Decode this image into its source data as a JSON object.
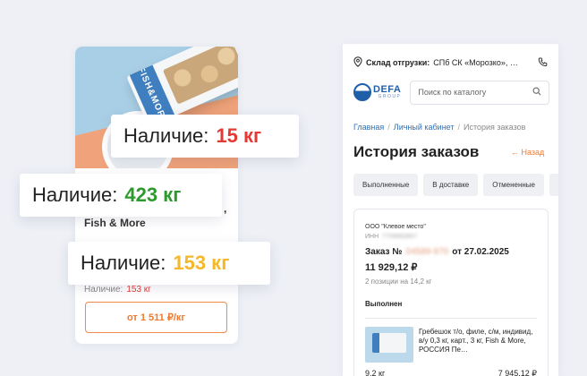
{
  "product": {
    "name_tail": "Fish & More",
    "name_clip": ",",
    "stock_label": "Наличие:",
    "stock_value": "153 кг",
    "price_button": "от 1 511 ₽/кг",
    "image_brand": "FISH&MORE"
  },
  "badges": [
    {
      "label": "Наличие:",
      "value": "15 кг",
      "color": "#e53935"
    },
    {
      "label": "Наличие:",
      "value": "423 кг",
      "color": "#2e9a2e"
    },
    {
      "label": "Наличие:",
      "value": "153 кг",
      "color": "#f5b82a"
    }
  ],
  "mobile": {
    "warehouse_label": "Склад отгрузки:",
    "warehouse_value": "СПб СК «Морозко», …",
    "logo_name": "DEFA",
    "logo_sub": "GROUP",
    "search_placeholder": "Поиск по каталогу",
    "breadcrumb": [
      "Главная",
      "Личный кабинет",
      "История заказов"
    ],
    "page_title": "История заказов",
    "back_label": "Назад",
    "tabs": [
      "Выполненные",
      "В доставке",
      "Отмененные"
    ],
    "order": {
      "company": "ООО \"Клевое место\"",
      "inn_label": "ИНН",
      "inn_value": "7709983857",
      "number_prefix": "Заказ №",
      "number_value": "04589-970",
      "date": "от 27.02.2025",
      "sum": "11 929,12 ₽",
      "positions": "2 позиции на 14,2 кг",
      "status": "Выполнен",
      "item": {
        "description": "Гребешок т/о, филе, с/м, индивид, в/у 0,3 кг, карт., 3 кг, Fish & More, РОССИЯ Пе…",
        "weight": "9,2 кг",
        "price": "7 945,12 ₽"
      }
    }
  },
  "colors": {
    "accent_orange": "#f07a2e",
    "link_blue": "#2f6fb5",
    "brand_blue": "#1f5fa8"
  }
}
